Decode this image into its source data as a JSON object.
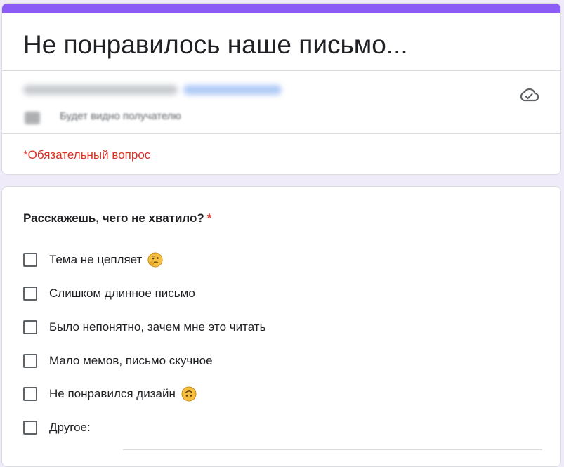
{
  "form": {
    "title": "Не понравилось наше письмо...",
    "accent_color": "#8b5cf6",
    "required_note": "*Обязательный вопрос",
    "account": {
      "share_note": "Будет видно получателю",
      "status_icon": "cloud-check-icon"
    }
  },
  "question": {
    "title": "Расскажешь, чего не хватило?",
    "required_mark": "*",
    "options": [
      {
        "label": "Тема не цепляет",
        "icon": "thinking-face-emoji",
        "checked": false
      },
      {
        "label": "Слишком длинное письмо",
        "checked": false
      },
      {
        "label": "Было непонятно, зачем мне это читать",
        "checked": false
      },
      {
        "label": "Мало мемов, письмо скучное",
        "checked": false
      },
      {
        "label": "Не понравился дизайн",
        "icon": "upside-down-face-emoji",
        "checked": false
      },
      {
        "label": "Другое:",
        "checked": false,
        "has_text_input": true,
        "text_value": ""
      }
    ]
  }
}
